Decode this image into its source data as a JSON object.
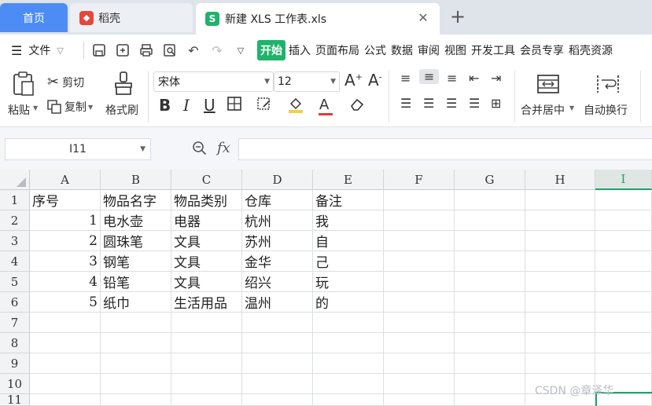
{
  "tabs": {
    "home": "首页",
    "doc": "稻壳",
    "active": "新建 XLS 工作表.xls",
    "active_icon": "S",
    "close": "✕",
    "add": "+"
  },
  "menu": {
    "file": "文件",
    "start": "开始",
    "items": [
      "插入",
      "页面布局",
      "公式",
      "数据",
      "审阅",
      "视图",
      "开发工具",
      "会员专享",
      "稻壳资源"
    ]
  },
  "ribbon": {
    "paste": "粘贴",
    "cut": "剪切",
    "copy": "复制",
    "format_painter": "格式刷",
    "font_name": "宋体",
    "font_size": "12",
    "merge_center": "合并居中",
    "wrap_text": "自动换行"
  },
  "formula": {
    "cell_ref": "I11",
    "fx": "fx",
    "value": ""
  },
  "sheet": {
    "columns": [
      "A",
      "B",
      "C",
      "D",
      "E",
      "F",
      "G",
      "H",
      "I"
    ],
    "selected_column": "I",
    "rows": [
      "1",
      "2",
      "3",
      "4",
      "5",
      "6",
      "7",
      "8",
      "9",
      "10",
      "11"
    ],
    "cells": [
      [
        "序号",
        "物品名字",
        "物品类别",
        "仓库",
        "备注"
      ],
      [
        "1",
        "电水壶",
        "电器",
        "杭州",
        "我"
      ],
      [
        "2",
        "圆珠笔",
        "文具",
        "苏州",
        "自"
      ],
      [
        "3",
        "钢笔",
        "文具",
        "金华",
        "己"
      ],
      [
        "4",
        "铅笔",
        "文具",
        "绍兴",
        "玩"
      ],
      [
        "5",
        "纸巾",
        "生活用品",
        "温州",
        "的"
      ]
    ]
  },
  "watermark": "CSDN @章泽华",
  "colors": {
    "accent_green": "#1fb36b",
    "home_tab_blue": "#4d8cf5",
    "doc_red": "#e8463b"
  }
}
